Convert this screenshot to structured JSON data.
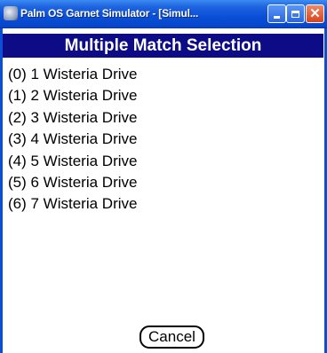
{
  "window": {
    "title": "Palm OS Garnet Simulator - [Simul..."
  },
  "form": {
    "title": "Multiple Match Selection",
    "matches": [
      "(0) 1 Wisteria Drive",
      "(1) 2 Wisteria Drive",
      "(2) 3 Wisteria Drive",
      "(3) 4 Wisteria Drive",
      "(4) 5 Wisteria Drive",
      "(5) 6 Wisteria Drive",
      "(6) 7 Wisteria Drive"
    ],
    "cancel_label": "Cancel"
  },
  "icons": {
    "app": "palm-app-icon",
    "minimize": "minimize-icon",
    "maximize": "maximize-icon",
    "close": "close-icon"
  },
  "colors": {
    "titlebar": "#0a4fd8",
    "form_title_bg": "#0d0c86",
    "close_button": "#d8431c"
  }
}
